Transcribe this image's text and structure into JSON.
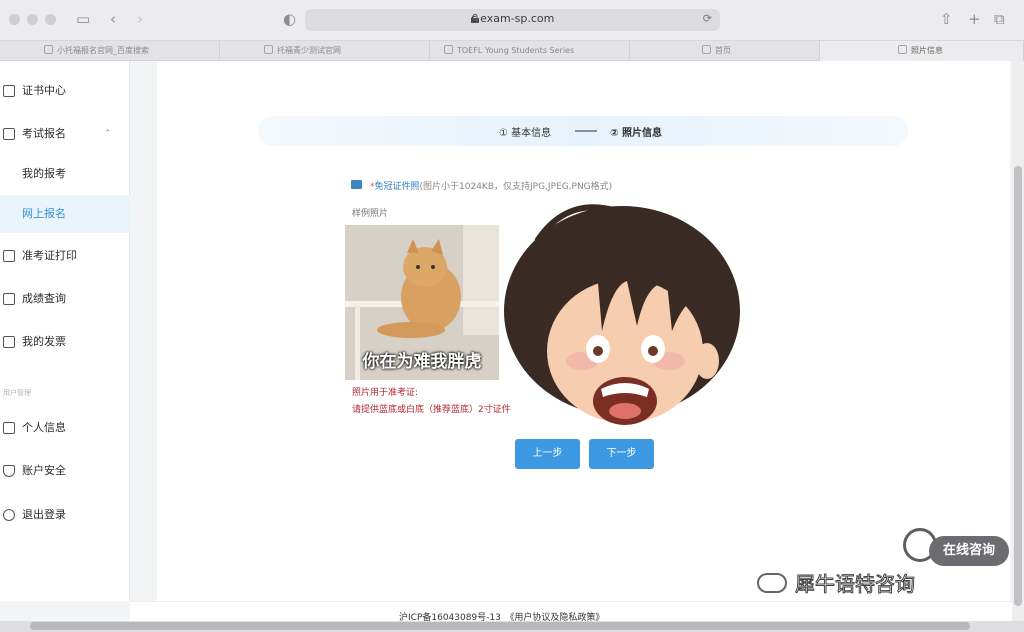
{
  "browser": {
    "url": "c.exam-sp.com",
    "tabs": [
      {
        "label": "小托福报名官网_百度搜索"
      },
      {
        "label": "托福青少测试官网"
      },
      {
        "label": "TOEFL Young Students Series"
      },
      {
        "label": "首页"
      },
      {
        "label": "照片信息"
      }
    ]
  },
  "sidebar": {
    "items": [
      {
        "label": "证书中心",
        "icon": "certificate-icon"
      },
      {
        "label": "考试报名",
        "icon": "register-icon"
      },
      {
        "label": "我的报考",
        "icon": ""
      },
      {
        "label": "网上报名",
        "icon": ""
      },
      {
        "label": "准考证打印",
        "icon": "printer-icon"
      },
      {
        "label": "成绩查询",
        "icon": "score-icon"
      },
      {
        "label": "我的发票",
        "icon": "invoice-icon"
      },
      {
        "label": "个人信息",
        "icon": "id-card-icon"
      },
      {
        "label": "账户安全",
        "icon": "shield-icon"
      },
      {
        "label": "退出登录",
        "icon": "power-icon"
      }
    ],
    "group_label": "用户管理"
  },
  "steps": {
    "step1": "① 基本信息",
    "step2": "② 照片信息"
  },
  "upload": {
    "required_star": "*",
    "required_title": "免冠证件照",
    "requirements": "(图片小于1024KB，仅支持JPG,JPEG,PNG格式)",
    "sample_label": "样例照片",
    "sample_caption": "你在为难我胖虎",
    "note_title": "照片用于准考证:",
    "note_text": "请提供蓝底或白底（推荐蓝底）2寸证件"
  },
  "buttons": {
    "prev": "上一步",
    "next": "下一步"
  },
  "footer": {
    "text": "沪ICP备16043089号-13　《用户协议及隐私政策》"
  },
  "consult": {
    "label": "在线咨询"
  },
  "watermark": {
    "text": "犀牛语特咨询"
  },
  "colors": {
    "accent": "#3d9ae2",
    "active_bg": "#eaf4fb",
    "warning": "#b4282e"
  }
}
